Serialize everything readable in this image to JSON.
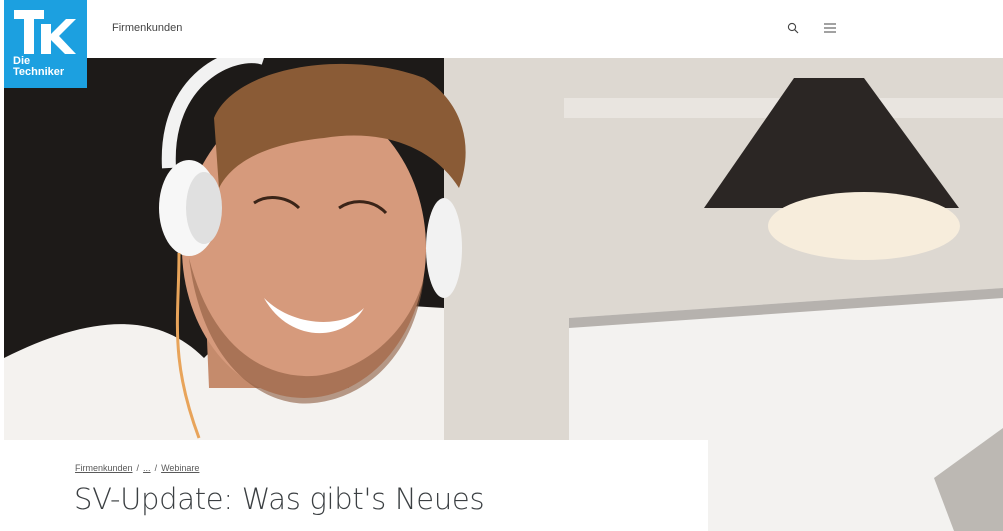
{
  "brand": {
    "logo_line1": "Die",
    "logo_line2": "Techniker",
    "accent": "#1ca0e0"
  },
  "header": {
    "nav_link": "Firmenkunden",
    "search_icon": "search-icon",
    "menu_icon": "menu-icon"
  },
  "breadcrumb": {
    "items": [
      "Firmenkunden",
      "...",
      "Webinare"
    ],
    "separator": "/"
  },
  "main": {
    "title": "SV-Update: Was gibt's Neues"
  }
}
